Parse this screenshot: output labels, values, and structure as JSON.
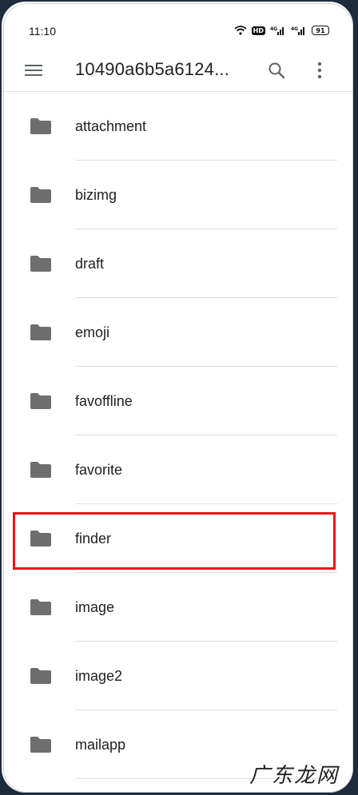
{
  "status_bar": {
    "time": "11:10",
    "network_1": "4G",
    "network_2": "4G",
    "hd_badge": "HD",
    "battery": "91"
  },
  "toolbar": {
    "title": "10490a6b5a6124..."
  },
  "folders": [
    {
      "label": "attachment"
    },
    {
      "label": "bizimg"
    },
    {
      "label": "draft"
    },
    {
      "label": "emoji"
    },
    {
      "label": "favoffline"
    },
    {
      "label": "favorite"
    },
    {
      "label": "finder"
    },
    {
      "label": "image"
    },
    {
      "label": "image2"
    },
    {
      "label": "mailapp"
    }
  ],
  "highlighted_folder": "finder",
  "watermark": "广东龙网",
  "colors": {
    "folder_icon": "#6e6e6e",
    "highlight": "#e8141a",
    "background": "#ffffff",
    "outer": "#1e2b3a"
  }
}
